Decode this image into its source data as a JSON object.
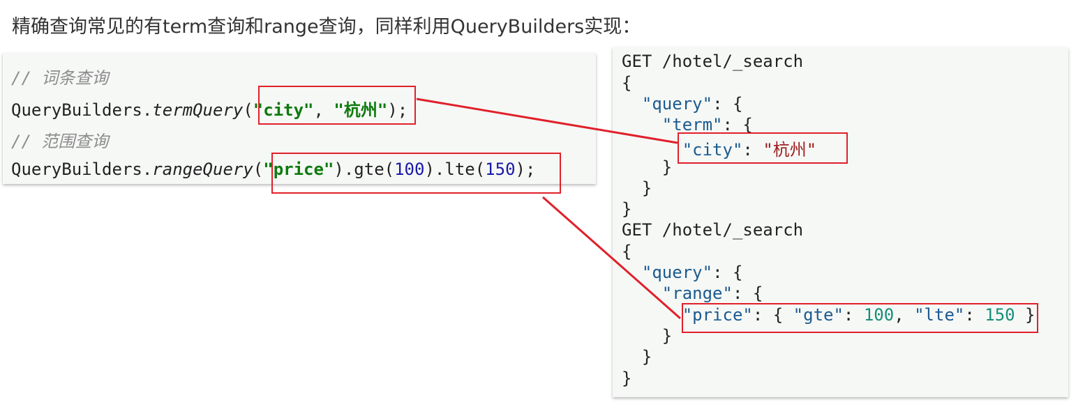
{
  "heading": "精确查询常见的有term查询和range查询，同样利用QueryBuilders实现：",
  "java": {
    "comment1": "// 词条查询",
    "term_prefix": "QueryBuilders.",
    "term_method": "termQuery",
    "term_open": "(",
    "term_field": "\"city\"",
    "term_sep": ", ",
    "term_value": "\"杭州\"",
    "term_close": ");",
    "comment2": "// 范围查询",
    "range_prefix": "QueryBuilders.",
    "range_method": "rangeQuery",
    "range_open": "(",
    "range_field": "\"price\"",
    "range_mid1": ").gte(",
    "range_gte": "100",
    "range_mid2": ").lte(",
    "range_lte": "150",
    "range_close": ");"
  },
  "dsl": {
    "request1": "GET /hotel/_search",
    "open_brace": "{",
    "close_brace": "}",
    "query_key": "\"query\"",
    "term_key": "\"term\"",
    "city_key": "\"city\"",
    "city_value": "\"杭州\"",
    "request2": "GET /hotel/_search",
    "range_key": "\"range\"",
    "price_key": "\"price\"",
    "gte_key": "\"gte\"",
    "gte_value": "100",
    "lte_key": "\"lte\"",
    "lte_value": "150",
    "colon": ": ",
    "colon_brace": ": {",
    "comma": ", "
  },
  "colors": {
    "highlight": "#e0202a",
    "java_string": "#0e7a0e",
    "json_key": "#1b5a8f",
    "json_string": "#9a1c1c",
    "json_number": "#178f7a"
  }
}
